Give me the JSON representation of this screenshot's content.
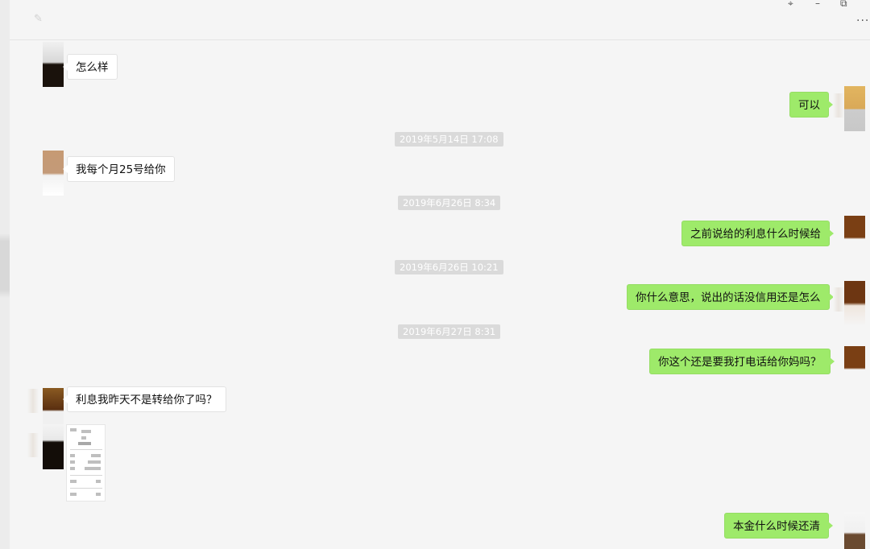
{
  "window": {
    "pin_icon": "pin-icon",
    "minimize_icon": "minimize-icon",
    "restore_icon": "restore-icon",
    "more_icon": "more-icon",
    "pin_glyph": "⌖",
    "minimize_glyph": "–",
    "restore_glyph": "⧉",
    "more_glyph": "···"
  },
  "chat": {
    "messages": [
      {
        "type": "incoming",
        "text": "怎么样"
      },
      {
        "type": "outgoing",
        "text": "可以"
      },
      {
        "type": "timestamp",
        "text": "2019年5月14日 17:08"
      },
      {
        "type": "incoming",
        "text": "我每个月25号给你"
      },
      {
        "type": "timestamp",
        "text": "2019年6月26日 8:34"
      },
      {
        "type": "outgoing",
        "text": "之前说给的利息什么时候给"
      },
      {
        "type": "timestamp",
        "text": "2019年6月26日 10:21"
      },
      {
        "type": "outgoing",
        "text": "你什么意思，说出的话没信用还是怎么"
      },
      {
        "type": "timestamp",
        "text": "2019年6月27日 8:31"
      },
      {
        "type": "outgoing",
        "text": "你这个还是要我打电话给你妈吗？"
      },
      {
        "type": "incoming",
        "text": "利息我昨天不是转给你了吗？"
      },
      {
        "type": "incoming-image",
        "text": ""
      },
      {
        "type": "outgoing",
        "text": "本金什么时候还清"
      }
    ]
  },
  "colors": {
    "outgoing_bubble": "#9eea6a",
    "incoming_bubble": "#ffffff",
    "timestamp_bg": "#dadada",
    "background": "#f5f5f5"
  }
}
